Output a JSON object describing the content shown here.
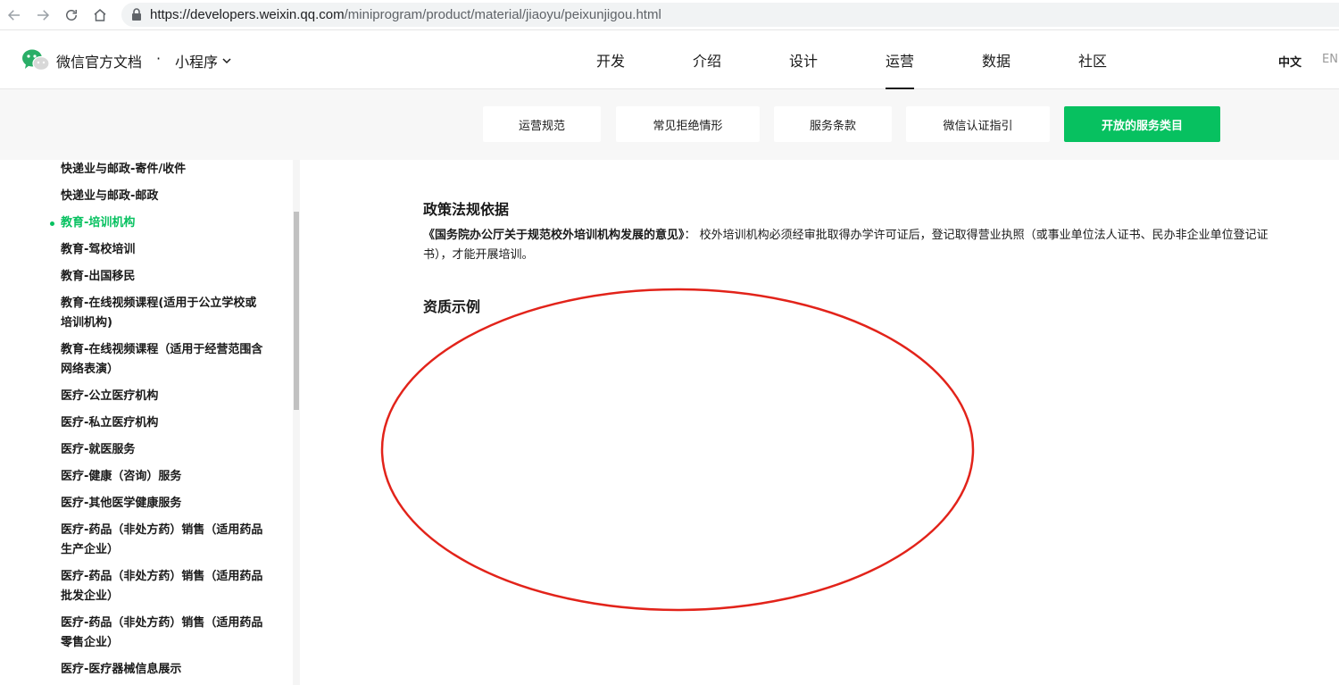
{
  "browser": {
    "url_host": "https://developers.weixin.qq.com",
    "url_path": "/miniprogram/product/material/jiaoyu/peixunjigou.html"
  },
  "header": {
    "site_name": "微信官方文档",
    "separator": "·",
    "product": "小程序",
    "nav": [
      "开发",
      "介绍",
      "设计",
      "运营",
      "数据",
      "社区"
    ],
    "active_nav": "运营",
    "lang_zh": "中文",
    "lang_en": "EN"
  },
  "subnav": {
    "buttons": [
      "运营规范",
      "常见拒绝情形",
      "服务条款",
      "微信认证指引",
      "开放的服务类目"
    ],
    "active": "开放的服务类目"
  },
  "sidebar": {
    "items": [
      "快递业与邮政-寄件/收件",
      "快递业与邮政-邮政",
      "教育-培训机构",
      "教育-驾校培训",
      "教育-出国移民",
      "教育-在线视频课程(适用于公立学校或培训机构)",
      "教育-在线视频课程（适用于经营范围含网络表演）",
      "医疗-公立医疗机构",
      "医疗-私立医疗机构",
      "医疗-就医服务",
      "医疗-健康（咨询）服务",
      "医疗-其他医学健康服务",
      "医疗-药品（非处方药）销售（适用药品生产企业）",
      "医疗-药品（非处方药）销售（适用药品批发企业）",
      "医疗-药品（非处方药）销售（适用药品零售企业）",
      "医疗-医疗器械信息展示"
    ],
    "active": "教育-培训机构"
  },
  "content": {
    "policy_title": "政策法规依据",
    "policy_doc": "《国务院办公厅关于规范校外培训机构发展的意见》",
    "policy_text": "： 校外培训机构必须经审批取得办学许可证后，登记取得营业执照（或事业单位法人证书、民办非企业单位登记证书），才能开展培训。",
    "example_title": "资质示例"
  },
  "colors": {
    "accent": "#07c160",
    "annotation": "#e2231a"
  }
}
